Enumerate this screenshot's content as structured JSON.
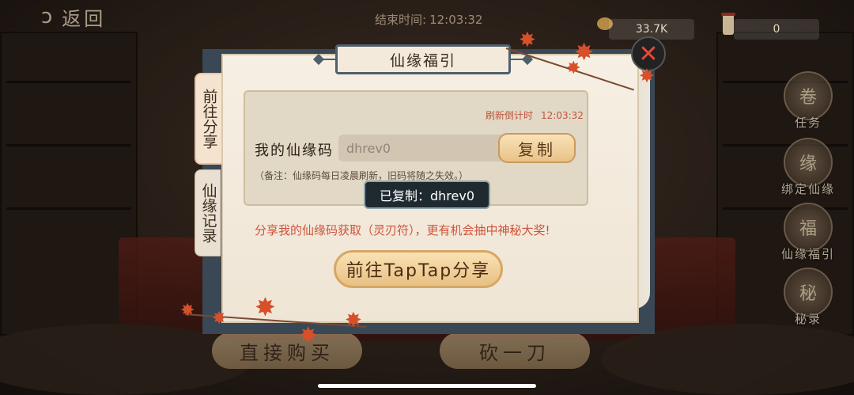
{
  "top_bar": {
    "back_label": "返回",
    "end_time_label": "结束时间:",
    "end_time_value": "12:03:32",
    "resource_a": "33.7K",
    "resource_b": "0"
  },
  "side_menu": [
    {
      "label": "任务",
      "icon": "scroll-task-icon"
    },
    {
      "label": "绑定仙缘",
      "icon": "bind-fate-icon"
    },
    {
      "label": "仙缘福引",
      "icon": "fate-lottery-icon"
    },
    {
      "label": "秘录",
      "icon": "secret-record-icon"
    }
  ],
  "bottom_buttons": {
    "buy": "直接购买",
    "cut": "砍一刀"
  },
  "dialog": {
    "title": "仙缘福引",
    "close_icon": "close-icon",
    "tabs": [
      {
        "label": "前往分享",
        "active": true
      },
      {
        "label": "仙缘记录",
        "active": false
      }
    ],
    "refresh_label": "刷新倒计时",
    "refresh_value": "12:03:32",
    "code_label": "我的仙缘码",
    "code_value": "dhrev0",
    "copy_label": "复制",
    "note": "（备注：仙缘码每日凌晨刷新，旧码将随之失效。）",
    "toast": "已复制：dhrev0",
    "share_hint": "分享我的仙缘码获取（灵刃符），更有机会抽中神秘大奖!",
    "share_button": "前往TapTap分享"
  },
  "colors": {
    "accent_red": "#d0533a",
    "button_gold": "#e8c287",
    "frame_slate": "#4f5f6c"
  }
}
